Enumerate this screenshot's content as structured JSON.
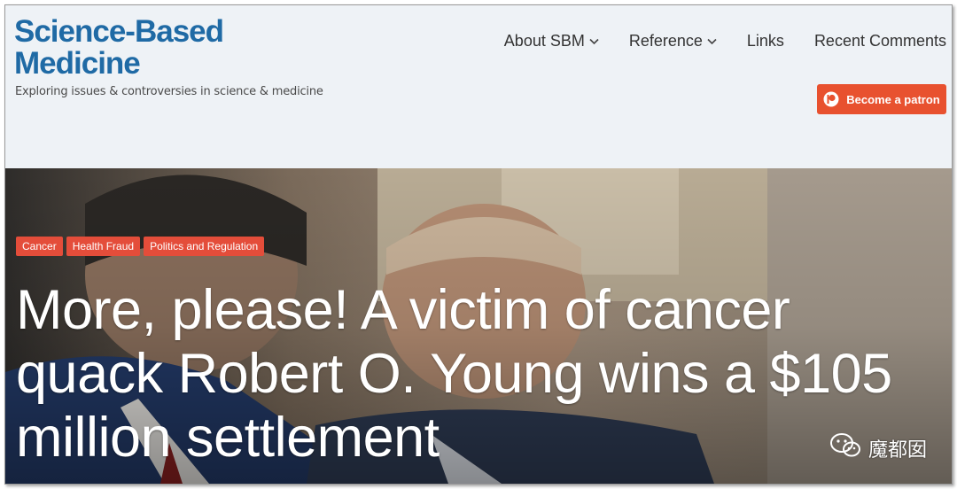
{
  "header": {
    "logo_line1": "Science-Based",
    "logo_line2": "Medicine",
    "tagline": "Exploring issues & controversies in science & medicine",
    "nav": [
      {
        "label": "About SBM",
        "has_dropdown": true
      },
      {
        "label": "Reference",
        "has_dropdown": true
      },
      {
        "label": "Links",
        "has_dropdown": false
      },
      {
        "label": "Recent Comments",
        "has_dropdown": false
      }
    ],
    "patron_button": {
      "label": "Become a patron",
      "icon": "patreon-icon",
      "color": "#e8512f"
    }
  },
  "hero": {
    "tags": [
      "Cancer",
      "Health Fraud",
      "Politics and Regulation"
    ],
    "tag_color": "#e44d3a",
    "headline_lines": [
      "More, please! A victim of cancer",
      "quack Robert O. Young wins a $105",
      "million settlement"
    ]
  },
  "watermark": {
    "text": "魔都囡",
    "icon": "wechat-icon"
  },
  "colors": {
    "brand": "#1f6aa5",
    "header_bg": "#eef2f6"
  }
}
